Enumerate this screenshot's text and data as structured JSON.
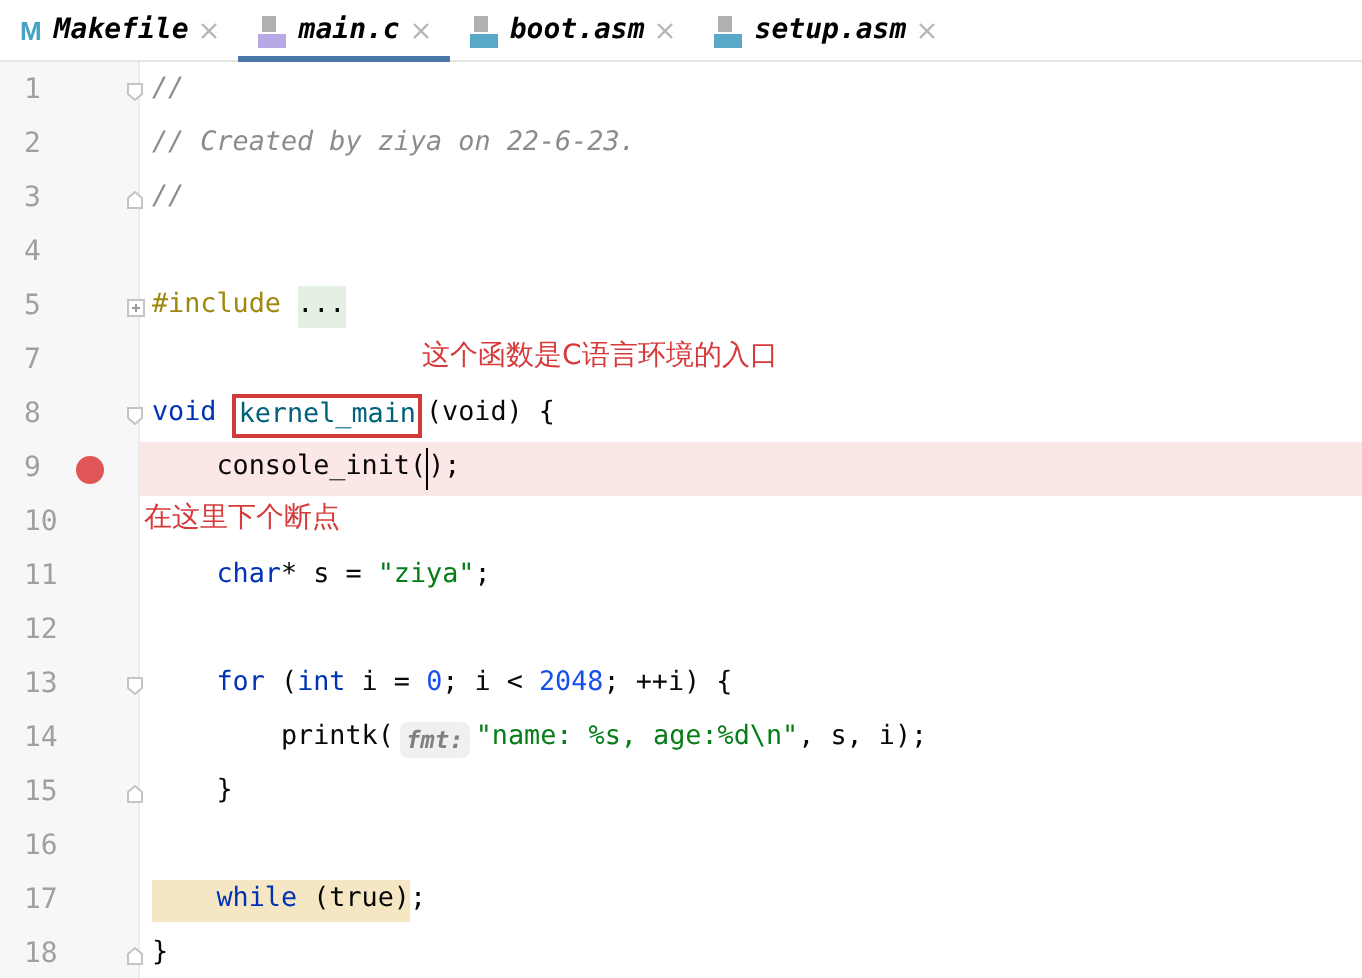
{
  "tabs": [
    {
      "label": "Makefile",
      "kind": "make",
      "icon_letter": "M",
      "selected": false
    },
    {
      "label": "main.c",
      "kind": "c",
      "selected": true
    },
    {
      "label": "boot.asm",
      "kind": "asm",
      "selected": false
    },
    {
      "label": "setup.asm",
      "kind": "asm",
      "selected": false
    }
  ],
  "lines": [
    {
      "number": "1",
      "fold": {
        "kind": "start"
      },
      "tokens": [
        {
          "kind": "comment",
          "text": "//"
        }
      ]
    },
    {
      "number": "2",
      "tokens": [
        {
          "kind": "comment",
          "text": "// Created by ziya on 22-6-23."
        }
      ]
    },
    {
      "number": "3",
      "fold": {
        "kind": "end"
      },
      "tokens": [
        {
          "kind": "comment",
          "text": "//"
        }
      ]
    },
    {
      "number": "4"
    },
    {
      "number": "5",
      "fold": {
        "kind": "collapsed"
      },
      "tokens": [
        {
          "kind": "preprocessor",
          "text": "#include "
        },
        {
          "kind": "folded",
          "text": "..."
        }
      ]
    },
    {
      "number": "7",
      "annotation": {
        "kind": "offset",
        "text": "这个函数是C语言环境的入口"
      }
    },
    {
      "number": "8",
      "fold": {
        "kind": "start"
      },
      "tokens": [
        {
          "kind": "keyword",
          "text": "void "
        },
        {
          "kind": "function",
          "text": "kernel_main",
          "boxed": true
        },
        {
          "kind": "plain",
          "text": "(void) {"
        }
      ]
    },
    {
      "number": "9",
      "breakpoint": true,
      "tokens": [
        {
          "kind": "plain",
          "text": "    console_init(",
          "caret_after": true
        },
        {
          "kind": "plain",
          "text": ");"
        }
      ]
    },
    {
      "number": "10",
      "annotation": {
        "kind": "inline",
        "text": "在这里下个断点"
      }
    },
    {
      "number": "11",
      "tokens": [
        {
          "kind": "keyword",
          "text": "    char"
        },
        {
          "kind": "plain",
          "text": "* s = "
        },
        {
          "kind": "string",
          "text": "\"ziya\""
        },
        {
          "kind": "plain",
          "text": ";"
        }
      ]
    },
    {
      "number": "12"
    },
    {
      "number": "13",
      "fold": {
        "kind": "start"
      },
      "tokens": [
        {
          "kind": "keyword",
          "text": "    for"
        },
        {
          "kind": "plain",
          "text": " ("
        },
        {
          "kind": "keyword",
          "text": "int"
        },
        {
          "kind": "plain",
          "text": " i = "
        },
        {
          "kind": "number",
          "text": "0"
        },
        {
          "kind": "plain",
          "text": "; i < "
        },
        {
          "kind": "number",
          "text": "2048"
        },
        {
          "kind": "plain",
          "text": "; ++i) {"
        }
      ]
    },
    {
      "number": "14",
      "tokens": [
        {
          "kind": "plain",
          "text": "        printk("
        },
        {
          "kind": "hint",
          "text": "fmt:"
        },
        {
          "kind": "string",
          "text": "\"name: %s, age:%d\\n\""
        },
        {
          "kind": "plain",
          "text": ", s, i);"
        }
      ]
    },
    {
      "number": "15",
      "fold": {
        "kind": "end"
      },
      "tokens": [
        {
          "kind": "plain",
          "text": "    }"
        }
      ]
    },
    {
      "number": "16"
    },
    {
      "number": "17",
      "tokens": [
        {
          "kind": "matched_keyword",
          "text": "    while"
        },
        {
          "kind": "matched",
          "text": " (true)"
        },
        {
          "kind": "plain",
          "text": ";"
        }
      ]
    },
    {
      "number": "18",
      "fold": {
        "kind": "end"
      },
      "tokens": [
        {
          "kind": "plain",
          "text": "}"
        }
      ]
    }
  ]
}
